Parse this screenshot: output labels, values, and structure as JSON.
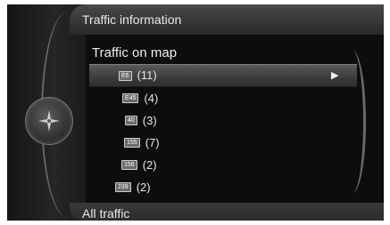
{
  "header": {
    "title": "Traffic information"
  },
  "list": {
    "title": "Traffic on map",
    "items": [
      {
        "badge": "E6",
        "count": "(11)",
        "selected": true
      },
      {
        "badge": "E45",
        "count": "(4)"
      },
      {
        "badge": "40",
        "count": "(3)"
      },
      {
        "badge": "155",
        "count": "(7)"
      },
      {
        "badge": "156",
        "count": "(2)"
      },
      {
        "badge": "239",
        "count": "(2)"
      }
    ]
  },
  "arrow_glyph": "▶",
  "footer": {
    "title": "All traffic"
  },
  "icons": {
    "nav_knob": "navigation-star-icon"
  }
}
